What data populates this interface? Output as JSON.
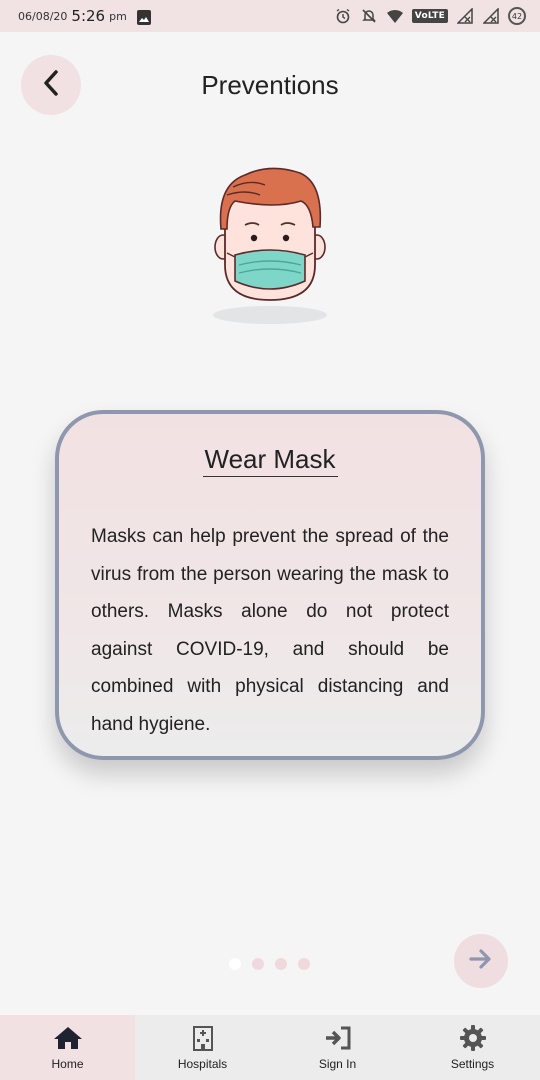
{
  "status_bar": {
    "date": "06/08/20",
    "time": "5:26",
    "ampm": "pm",
    "network_label": "VoLTE",
    "battery": "42",
    "icons": [
      "gallery-icon",
      "alarm-icon",
      "mute-icon",
      "wifi-icon",
      "signal-icon",
      "signal-icon",
      "battery-icon"
    ]
  },
  "header": {
    "title": "Preventions",
    "back_icon": "chevron-left-icon"
  },
  "illustration": {
    "icon": "person-wearing-mask-illustration"
  },
  "card": {
    "title": "Wear Mask",
    "body": "Masks can help prevent the spread of the virus from the person wearing the mask to others. Masks alone do not protect against COVID-19, and should be combined with physical distancing and hand hygiene."
  },
  "pager": {
    "total": 4,
    "active_index": 0,
    "next_icon": "arrow-right-icon"
  },
  "bottom_nav": {
    "items": [
      {
        "label": "Home",
        "icon": "home-icon",
        "active": true
      },
      {
        "label": "Hospitals",
        "icon": "hospital-icon",
        "active": false
      },
      {
        "label": "Sign In",
        "icon": "sign-in-icon",
        "active": false
      },
      {
        "label": "Settings",
        "icon": "gear-icon",
        "active": false
      }
    ]
  },
  "colors": {
    "accent_pink": "#f1e1e2",
    "card_border": "#8f97ae",
    "mask": "#7ed6c8",
    "hair": "#d9714f"
  }
}
